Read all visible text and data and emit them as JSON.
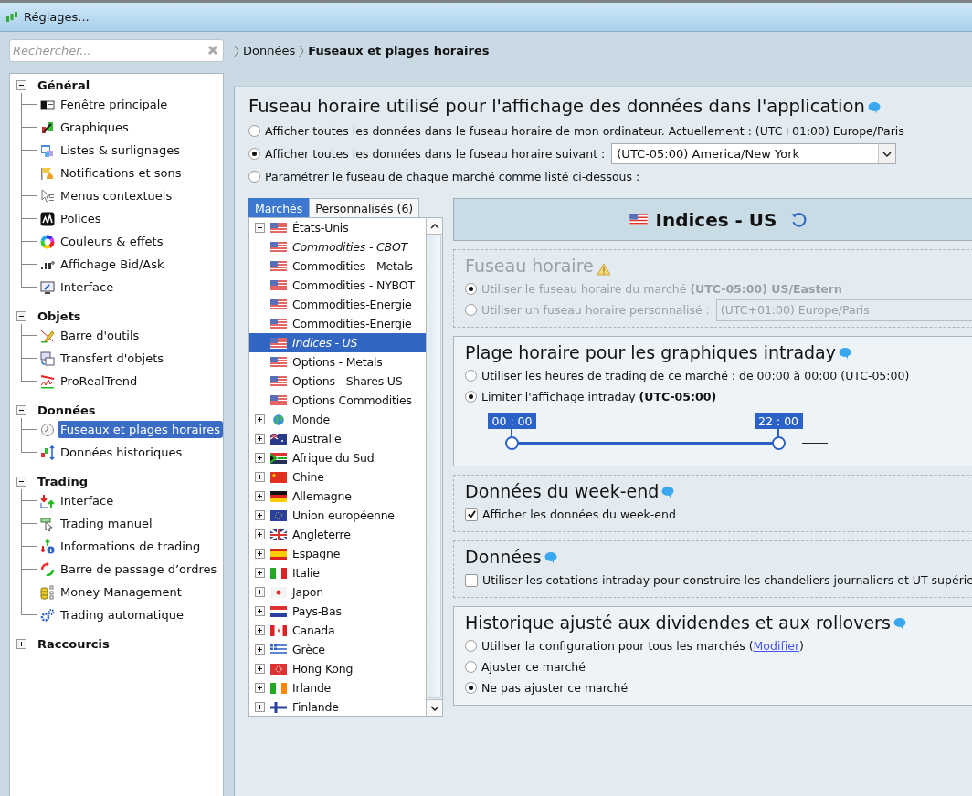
{
  "window": {
    "title": "Réglages..."
  },
  "search": {
    "placeholder": "Rechercher..."
  },
  "breadcrumb": [
    {
      "label": "Données",
      "current": false
    },
    {
      "label": "Fuseaux et plages horaires",
      "current": true
    }
  ],
  "sidebar": {
    "groups": [
      {
        "label": "Général",
        "expanded": true,
        "items": [
          {
            "label": "Fenêtre principale",
            "selected": false
          },
          {
            "label": "Graphiques",
            "selected": false
          },
          {
            "label": "Listes & surlignages",
            "selected": false
          },
          {
            "label": "Notifications et sons",
            "selected": false
          },
          {
            "label": "Menus contextuels",
            "selected": false
          },
          {
            "label": "Polices",
            "selected": false
          },
          {
            "label": "Couleurs & effets",
            "selected": false
          },
          {
            "label": "Affichage Bid/Ask",
            "selected": false
          },
          {
            "label": "Interface",
            "selected": false
          }
        ]
      },
      {
        "label": "Objets",
        "expanded": true,
        "items": [
          {
            "label": "Barre d'outils",
            "selected": false
          },
          {
            "label": "Transfert d'objets",
            "selected": false
          },
          {
            "label": "ProRealTrend",
            "selected": false
          }
        ]
      },
      {
        "label": "Données",
        "expanded": true,
        "items": [
          {
            "label": "Fuseaux et plages horaires",
            "selected": true
          },
          {
            "label": "Données historiques",
            "selected": false
          }
        ]
      },
      {
        "label": "Trading",
        "expanded": true,
        "items": [
          {
            "label": "Interface",
            "selected": false
          },
          {
            "label": "Trading manuel",
            "selected": false
          },
          {
            "label": "Informations de trading",
            "selected": false
          },
          {
            "label": "Barre de passage d’ordres",
            "selected": false
          },
          {
            "label": "Money Management",
            "selected": false
          },
          {
            "label": "Trading automatique",
            "selected": false
          }
        ]
      },
      {
        "label": "Raccourcis",
        "expanded": false
      }
    ]
  },
  "timezone": {
    "title": "Fuseau horaire utilisé pour l'affichage des données dans l'application",
    "options": [
      {
        "label": "Afficher toutes les données dans le fuseau horaire de mon ordinateur. Actuellement : (UTC+01:00) Europe/Paris",
        "selected": false
      },
      {
        "label": "Afficher toutes les données dans le fuseau horaire suivant :",
        "selected": true,
        "dropdown": "(UTC-05:00) America/New York"
      },
      {
        "label": "Paramétrer le fuseau de chaque marché comme listé ci-dessous :",
        "selected": false
      }
    ]
  },
  "market_tabs": [
    {
      "label": "Marchés",
      "selected": true
    },
    {
      "label": "Personnalisés (6)",
      "selected": false
    }
  ],
  "market_tree": [
    {
      "label": "États-Unis",
      "expanded": true,
      "children": [
        {
          "label": "Commodities - CBOT",
          "italic": true,
          "selected": false
        },
        {
          "label": "Commodities - Metals",
          "italic": false,
          "selected": false
        },
        {
          "label": "Commodities - NYBOT",
          "italic": false,
          "selected": false
        },
        {
          "label": "Commodities-Energie",
          "italic": false,
          "selected": false
        },
        {
          "label": "Commodities-Energie",
          "italic": false,
          "selected": false
        },
        {
          "label": "Indices - US",
          "italic": true,
          "selected": true
        },
        {
          "label": "Options - Metals",
          "italic": false,
          "selected": false
        },
        {
          "label": "Options - Shares US",
          "italic": false,
          "selected": false
        },
        {
          "label": "Options Commodities",
          "italic": false,
          "selected": false
        }
      ]
    },
    {
      "label": "Monde",
      "expanded": false
    },
    {
      "label": "Australie",
      "expanded": false
    },
    {
      "label": "Afrique du Sud",
      "expanded": false
    },
    {
      "label": "Chine",
      "expanded": false
    },
    {
      "label": "Allemagne",
      "expanded": false
    },
    {
      "label": "Union européenne",
      "expanded": false
    },
    {
      "label": "Angleterre",
      "expanded": false
    },
    {
      "label": "Espagne",
      "expanded": false
    },
    {
      "label": "Italie",
      "expanded": false
    },
    {
      "label": "Japon",
      "expanded": false
    },
    {
      "label": "Pays-Bas",
      "expanded": false
    },
    {
      "label": "Canada",
      "expanded": false
    },
    {
      "label": "Grèce",
      "expanded": false
    },
    {
      "label": "Hong Kong",
      "expanded": false
    },
    {
      "label": "Irlande",
      "expanded": false
    },
    {
      "label": "Finlande",
      "expanded": false
    }
  ],
  "market": {
    "name": "Indices - US"
  },
  "market_timezone": {
    "title": "Fuseau horaire",
    "disabled": true,
    "options": [
      {
        "label": "Utiliser le fuseau horaire du marché **(UTC-05:00) US/Eastern**",
        "selected": true
      },
      {
        "label": "Utiliser un fuseau horaire personnalisé :",
        "selected": false,
        "dropdown": "(UTC+01:00) Europe/Paris"
      }
    ]
  },
  "intraday": {
    "title": "Plage horaire pour les graphiques intraday",
    "options": [
      {
        "label": "Utiliser les heures de trading de ce marché : de 00:00 à 00:00 (UTC-05:00)",
        "selected": false
      },
      {
        "label": "Limiter l'affichage intraday **(UTC-05:00)**",
        "selected": true
      }
    ],
    "handles": [
      {
        "label": "00 : 00",
        "level": 0
      },
      {
        "label": "22 : 00",
        "level": 0.917
      }
    ]
  },
  "weekend": {
    "title": "Données du week-end",
    "checkbox": {
      "label": "Afficher les données du week-end",
      "checked": true
    }
  },
  "data": {
    "title": "Données",
    "checkbox": {
      "label": "Utiliser les cotations intraday pour construire les chandeliers journaliers et UT supérie",
      "checked": false
    }
  },
  "dividends": {
    "title": "Historique ajusté aux dividendes et aux rollovers",
    "options": [
      {
        "label": "Utiliser la configuration pour tous les marchés (",
        "link": "Modifier",
        "after": ")",
        "selected": false
      },
      {
        "label": "Ajuster ce marché",
        "selected": false
      },
      {
        "label": "Ne pas ajuster ce marché",
        "selected": true
      }
    ]
  }
}
